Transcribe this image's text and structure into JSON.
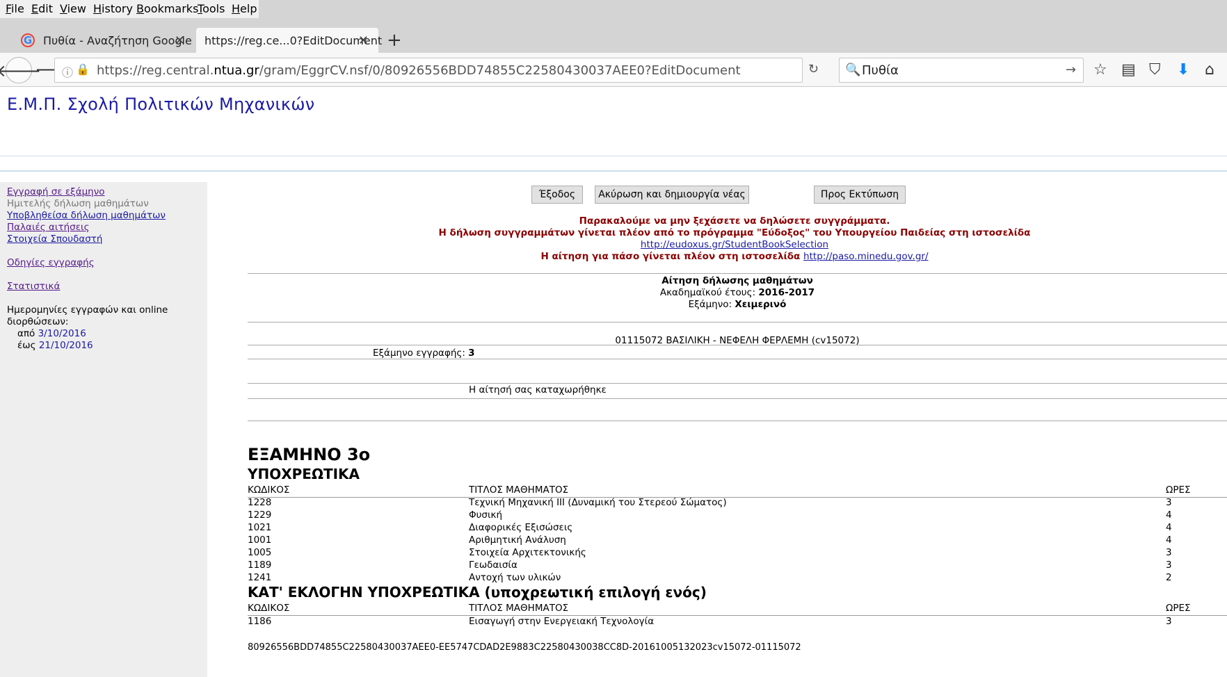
{
  "browser": {
    "menu": [
      {
        "accel": "F",
        "rest": "ile"
      },
      {
        "accel": "E",
        "rest": "dit"
      },
      {
        "accel": "V",
        "rest": "iew"
      },
      {
        "accel": "H",
        "rest": "istory"
      },
      {
        "accel": "B",
        "rest": "ookmarks"
      },
      {
        "accel": "T",
        "rest": "ools"
      },
      {
        "accel": "H",
        "rest": "elp"
      }
    ],
    "tabs": [
      {
        "label": "Πυθία - Αναζήτηση Google"
      },
      {
        "label": "https://reg.ce...0?EditDocument"
      }
    ],
    "url_prefix": "https://reg.central.",
    "url_domain": "ntua.gr",
    "url_suffix": "/gram/EggrCV.nsf/0/80926556BDD74855C22580430037AEE0?EditDocument",
    "search_value": "Πυθία",
    "icons": {
      "google": "G",
      "close": "✕",
      "newtab": "+",
      "back": "🡐",
      "forward": "🡒",
      "info": "ⓘ",
      "lock": "🔒",
      "reload": "↻",
      "search": "🔍",
      "go": "→",
      "bookmark": "☆",
      "library": "▤",
      "pocket": "⛉",
      "download": "⬇",
      "home": "⌂"
    }
  },
  "site": {
    "title": "Ε.Μ.Π. Σχολή Πολιτικών Μηχανικών"
  },
  "sidebar": {
    "links": [
      {
        "label": "Εγγραφή σε εξάμηνο"
      },
      {
        "label": "Ημιτελής δήλωση μαθημάτων"
      },
      {
        "label": "Υποβληθείσα δήλωση μαθημάτων"
      },
      {
        "label": "Παλαιές αιτήσεις"
      },
      {
        "label": "Στοιχεία Σπουδαστή"
      },
      {
        "label": "Οδηγίες εγγραφής"
      },
      {
        "label": "Στατιστικά"
      }
    ],
    "dates_label": "Ημερομηνίες εγγραφών και online",
    "dates_label2": "διορθώσεων:",
    "from_label": "από",
    "from_date": "3/10/2016",
    "to_label": "έως",
    "to_date": "21/10/2016"
  },
  "buttons": {
    "exit": "Έξοδος",
    "cancel_new": "Ακύρωση και δημιουργία νέας",
    "print": "Προς Εκτύπωση"
  },
  "notice": {
    "line1": "Παρακαλούμε να μην ξεχάσετε να δηλώσετε συγγράμματα.",
    "line2": "Η δήλωση συγγραμμάτων γίνεται πλέον από το πρόγραμμα \"Εύδοξος\" του Υπουργείου Παιδείας στη ιστοσελίδα",
    "link1": "http://eudoxus.gr/StudentBookSelection",
    "line4": "Η αίτηση για πάσο γίνεται πλέον στη ιστοσελίδα",
    "link2": "http://paso.minedu.gov.gr/"
  },
  "application": {
    "title": "Αίτηση δήλωσης μαθημάτων",
    "year_label": "Ακαδημαϊκού έτους:",
    "year": "2016-2017",
    "semester_label": "Εξάμηνο:",
    "semester": "Χειμερινό",
    "student": "01115072 ΒΑΣΙΛΙΚΗ - ΝΕΦΕΛΗ ΦΕΡΛΕΜΗ (cv15072)",
    "reg_semester_label": "Εξάμηνο εγγραφής:",
    "reg_semester": "3",
    "status": "Η αίτησή σας καταχωρήθηκε"
  },
  "courses": {
    "semester_heading": "ΕΞΑΜΗΝΟ 3ο",
    "mandatory_heading": "ΥΠΟΧΡΕΩΤΙΚΑ",
    "elective_heading": "ΚΑΤ' ΕΚΛΟΓΗΝ ΥΠΟΧΡΕΩΤΙΚΑ (υποχρεωτική επιλογή ενός)",
    "columns": {
      "code": "ΚΩΔΙΚΟΣ",
      "title": "ΤΙΤΛΟΣ ΜΑΘΗΜΑΤΟΣ",
      "hours": "ΩΡΕΣ"
    },
    "mandatory": [
      {
        "code": "1228",
        "title": "Τεχνική Μηχανική ΙΙΙ (Δυναμική του Στερεού Σώματος)",
        "hours": "3"
      },
      {
        "code": "1229",
        "title": "Φυσική",
        "hours": "4"
      },
      {
        "code": "1021",
        "title": "Διαφορικές Εξισώσεις",
        "hours": "4"
      },
      {
        "code": "1001",
        "title": "Αριθμητική Ανάλυση",
        "hours": "4"
      },
      {
        "code": "1005",
        "title": "Στοιχεία Αρχιτεκτονικής",
        "hours": "3"
      },
      {
        "code": "1189",
        "title": "Γεωδαισία",
        "hours": "3"
      },
      {
        "code": "1241",
        "title": "Αντοχή των υλικών",
        "hours": "2"
      }
    ],
    "elective": [
      {
        "code": "1186",
        "title": "Εισαγωγή στην Ενεργειακή Τεχνολογία",
        "hours": "3"
      }
    ]
  },
  "footer": {
    "doc_id": "80926556BDD74855C22580430037AEE0-EE5747CDAD2E9883C22580430038CC8D-20161005132023cv15072-01115072"
  }
}
